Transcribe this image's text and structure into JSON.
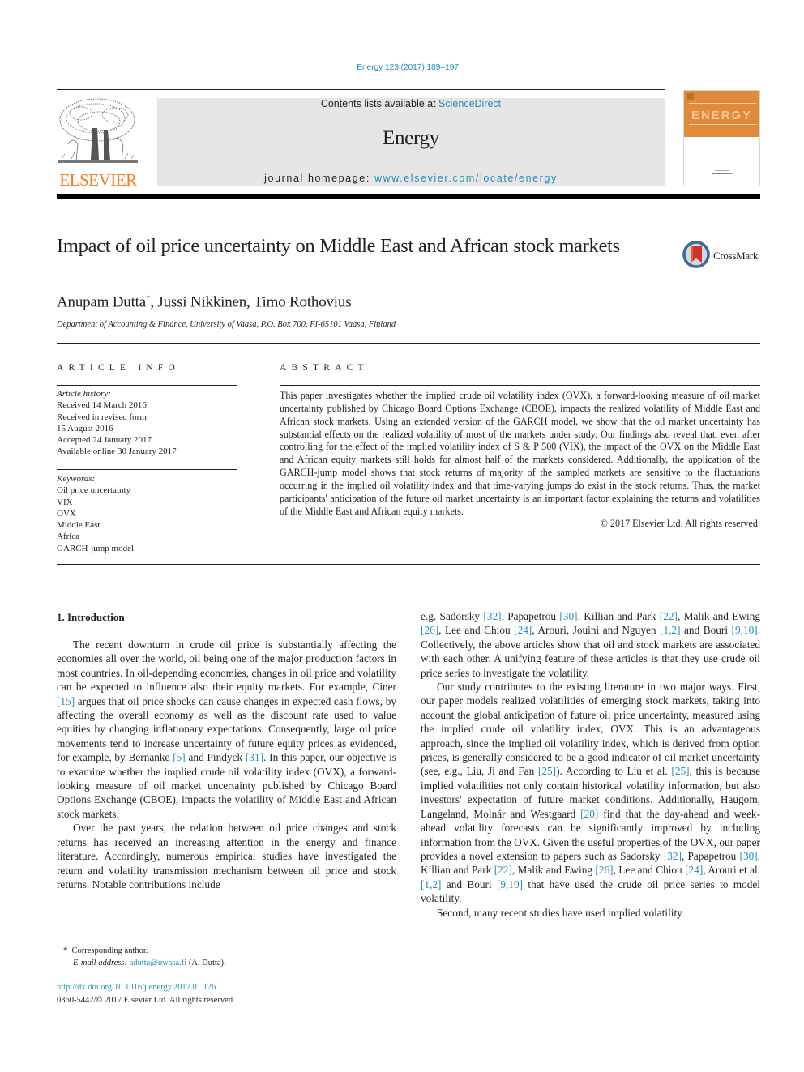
{
  "header": {
    "citation": "Energy 123 (2017) 189–197",
    "contents_prefix": "Contents lists available at ",
    "contents_link": "ScienceDirect",
    "journal_name": "Energy",
    "homepage_prefix": "journal homepage: ",
    "homepage_link": "www.elsevier.com/locate/energy",
    "publisher_logo_text": "ELSEVIER",
    "cover_title": "ENERGY",
    "colors": {
      "link": "#2a8cb8",
      "elsevier_orange": "#f47b20",
      "cover_orange": "#e08a3a",
      "banner_gray": "#e6e6e6"
    }
  },
  "article": {
    "title": "Impact of oil price uncertainty on Middle East and African stock markets",
    "crossmark_label": "CrossMark",
    "authors": [
      {
        "name": "Anupam Dutta",
        "mark": "*"
      },
      {
        "name": "Jussi Nikkinen"
      },
      {
        "name": "Timo Rothovius"
      }
    ],
    "authors_sep": ", ",
    "affiliation": "Department of Accounting & Finance, University of Vaasa, P.O. Box 700, FI-65101 Vaasa, Finland"
  },
  "article_info": {
    "heading": "ARTICLE INFO",
    "history_label": "Article history:",
    "history": [
      "Received 14 March 2016",
      "Received in revised form",
      "15 August 2016",
      "Accepted 24 January 2017",
      "Available online 30 January 2017"
    ],
    "keywords_label": "Keywords:",
    "keywords": [
      "Oil price uncertainty",
      "VIX",
      "OVX",
      "Middle East",
      "Africa",
      "GARCH-jump model"
    ]
  },
  "abstract": {
    "heading": "ABSTRACT",
    "text": "This paper investigates whether the implied crude oil volatility index (OVX), a forward-looking measure of oil market uncertainty published by Chicago Board Options Exchange (CBOE), impacts the realized volatility of Middle East and African stock markets. Using an extended version of the GARCH model, we show that the oil market uncertainty has substantial effects on the realized volatility of most of the markets under study. Our findings also reveal that, even after controlling for the effect of the implied volatility index of S & P 500 (VIX), the impact of the OVX on the Middle East and African equity markets still holds for almost half of the markets considered. Additionally, the application of the GARCH-jump model shows that stock returns of majority of the sampled markets are sensitive to the fluctuations occurring in the implied oil volatility index and that time-varying jumps do exist in the stock returns. Thus, the market participants' anticipation of the future oil market uncertainty is an important factor explaining the returns and volatilities of the Middle East and African equity markets.",
    "copyright": "© 2017 Elsevier Ltd. All rights reserved."
  },
  "body": {
    "section_heading": "1.  Introduction",
    "left_paragraphs": [
      {
        "segments": [
          {
            "t": "The recent downturn in crude oil price is substantially affecting the economies all over the world, oil being one of the major production factors in most countries. In oil-depending economies, changes in oil price and volatility can be expected to influence also their equity markets. For example, Ciner "
          },
          {
            "ref": "[15]"
          },
          {
            "t": " argues that oil price shocks can cause changes in expected cash flows, by affecting the overall economy as well as the discount rate used to value equities by changing inflationary expectations. Consequently, large oil price movements tend to increase uncertainty of future equity prices as evidenced, for example, by Bernanke "
          },
          {
            "ref": "[5]"
          },
          {
            "t": " and Pindyck "
          },
          {
            "ref": "[31]"
          },
          {
            "t": ". In this paper, our objective is to examine whether the implied crude oil volatility index (OVX), a forward-looking measure of oil market uncertainty published by Chicago Board Options Exchange (CBOE), impacts the volatility of Middle East and African stock markets."
          }
        ]
      },
      {
        "segments": [
          {
            "t": "Over the past years, the relation between oil price changes and stock returns has received an increasing attention in the energy and finance literature. Accordingly, numerous empirical studies have investigated the return and volatility transmission mechanism between oil price and stock returns. Notable contributions include"
          }
        ]
      }
    ],
    "right_paragraphs": [
      {
        "noindent": true,
        "segments": [
          {
            "t": "e.g. Sadorsky "
          },
          {
            "ref": "[32]"
          },
          {
            "t": ", Papapetrou "
          },
          {
            "ref": "[30]"
          },
          {
            "t": ", Killian and Park "
          },
          {
            "ref": "[22]"
          },
          {
            "t": ", Malik and Ewing "
          },
          {
            "ref": "[26]"
          },
          {
            "t": ", Lee and Chiou "
          },
          {
            "ref": "[24]"
          },
          {
            "t": ", Arouri, Jouini and Nguyen "
          },
          {
            "ref": "[1,2]"
          },
          {
            "t": " and Bouri "
          },
          {
            "ref": "[9,10]"
          },
          {
            "t": ". Collectively, the above articles show that oil and stock markets are associated with each other. A unifying feature of these articles is that they use crude oil price series to investigate the volatility."
          }
        ]
      },
      {
        "segments": [
          {
            "t": "Our study contributes to the existing literature in two major ways. First, our paper models realized volatilities of emerging stock markets, taking into account the global anticipation of future oil price uncertainty, measured using the implied crude oil volatility index, OVX. This is an advantageous approach, since the implied oil volatility index, which is derived from option prices, is generally considered to be a good indicator of oil market uncertainty (see, e.g., Liu, Ji and Fan "
          },
          {
            "ref": "[25]"
          },
          {
            "t": "). According to Liu et al. "
          },
          {
            "ref": "[25]"
          },
          {
            "t": ", this is because implied volatilities not only contain historical volatility information, but also investors' expectation of future market conditions. Additionally, Haugom, Langeland, Molnár and Westgaard "
          },
          {
            "ref": "[20]"
          },
          {
            "t": " find that the day-ahead and week-ahead volatility forecasts can be significantly improved by including information from the OVX. Given the useful properties of the OVX, our paper provides a novel extension to papers such as Sadorsky "
          },
          {
            "ref": "[32]"
          },
          {
            "t": ", Papapetrou "
          },
          {
            "ref": "[30]"
          },
          {
            "t": ", Killian and Park "
          },
          {
            "ref": "[22]"
          },
          {
            "t": ", Malik and Ewing "
          },
          {
            "ref": "[26]"
          },
          {
            "t": ", Lee and Chiou "
          },
          {
            "ref": "[24]"
          },
          {
            "t": ", Arouri et al. "
          },
          {
            "ref": "[1,2]"
          },
          {
            "t": " and Bouri "
          },
          {
            "ref": "[9,10]"
          },
          {
            "t": " that have used the crude oil price series to model volatility."
          }
        ]
      },
      {
        "segments": [
          {
            "t": "Second, many recent studies have used implied volatility"
          }
        ]
      }
    ]
  },
  "footnote": {
    "mark": "*",
    "corresponding": "Corresponding author.",
    "email_label": "E-mail address:",
    "email": "adutta@uwasa.fi",
    "email_suffix": " (A. Dutta)."
  },
  "doi": {
    "url": "http://dx.doi.org/10.1016/j.energy.2017.01.126",
    "issn_line": "0360-5442/© 2017 Elsevier Ltd. All rights reserved."
  }
}
